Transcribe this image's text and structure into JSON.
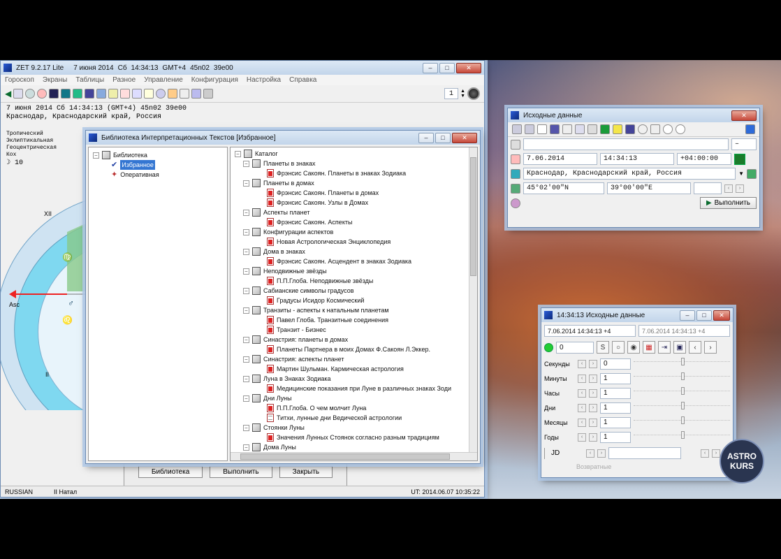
{
  "main_window": {
    "title": "ZET 9.2.17 Lite",
    "title_date": "7 июня 2014",
    "title_day": "Сб",
    "title_time": "14:34:13",
    "title_tz": "GMT+4",
    "title_lat": "45n02",
    "title_lon": "39e00",
    "menu": [
      "Гороскоп",
      "Экраны",
      "Таблицы",
      "Разное",
      "Управление",
      "Конфигурация",
      "Настройка",
      "Справка"
    ],
    "page_number": "1",
    "info_line1": "7 июня 2014   Сб   14:34:13  (GMT+4) 45n02  39e00",
    "info_line2": "Краснодар, Краснодарский край, Россия",
    "left_labels": [
      "Тропический",
      "Эклиптикальная",
      "Геоцентрическая",
      "Кох"
    ],
    "moon_label": "10",
    "chart_labels": {
      "xii": "XII",
      "ii": "II",
      "asc": "Asc"
    },
    "glyphs": [
      "♍",
      "♂",
      "♌"
    ],
    "status_lang": "RUSSIAN",
    "status_natal": "II Натал",
    "status_ut": "UT: 2014.06.07 10:35:22"
  },
  "hidden_dialog": {
    "library_button": "Библиотека",
    "execute_button": "Выполнить",
    "close_button": "Закрыть"
  },
  "library_window": {
    "title": "Библиотека Интерпретационных Текстов [Избранное]",
    "left_root": "Библиотека",
    "left_items": [
      "Избранное",
      "Оперативная"
    ],
    "catalog_root": "Каталог",
    "categories": [
      {
        "name": "Планеты в знаках",
        "items": [
          "Фрэнсис Сакоян. Планеты в знаках Зодиака"
        ]
      },
      {
        "name": "Планеты в домах",
        "items": [
          "Фрэнсис Сакоян. Планеты в домах",
          "Фрэнсис Сакоян. Узлы в Домах"
        ]
      },
      {
        "name": "Аспекты планет",
        "items": [
          "Фрэнсис Сакоян. Аспекты"
        ]
      },
      {
        "name": "Конфигурации аспектов",
        "items": [
          "Новая Астрологическая Энциклопедия"
        ]
      },
      {
        "name": "Дома в знаках",
        "items": [
          "Фрэнсис Сакоян. Асцендент в знаках Зодиака"
        ]
      },
      {
        "name": "Неподвижные звёзды",
        "items": [
          "П.П.Глоба. Неподвижные звёзды"
        ]
      },
      {
        "name": "Сабианские символы градусов",
        "items": [
          "Градусы Исидор Космический"
        ]
      },
      {
        "name": "Транзиты - аспекты к натальным планетам",
        "items": [
          "Павел Глоба. Транзитные соединения",
          "Транзит - Бизнес"
        ]
      },
      {
        "name": "Синастрия: планеты в домах",
        "items": [
          "Планеты Партнера в моих Домах Ф.Сакоян Л.Эккер."
        ]
      },
      {
        "name": "Синастрия: аспекты планет",
        "items": [
          "Мартин Шульман. Кармическая астрология"
        ]
      },
      {
        "name": "Луна в Знаках Зодиака",
        "items": [
          "Медицинские показания при Луне в различных знаках Зоди"
        ]
      },
      {
        "name": "Дни Луны",
        "items": [
          "П.П.Глоба. О чем молчит Луна",
          "Титхи, лунные дни Ведической астрологии"
        ]
      },
      {
        "name": "Стоянки Луны",
        "items": [
          "Значения Лунных Стоянок согласно разным традициям"
        ]
      },
      {
        "name": "Дома Луны",
        "items": []
      }
    ]
  },
  "source_window": {
    "title": "Исходные данные",
    "date": "7.06.2014",
    "time": "14:34:13",
    "offset": "+04:00:00",
    "place": "Краснодар, Краснодарский край, Россия",
    "latitude": "45°02'00\"N",
    "longitude": "39°00'00\"E",
    "name_value": "",
    "execute_label": "Выполнить",
    "tz_select": "–"
  },
  "time_window": {
    "title": "14:34:13 Исходные данные",
    "header_left": "7.06.2014  14:34:13  +4",
    "header_right": "7.06.2014   14:34:13  +4",
    "step_value": "0",
    "rows": [
      {
        "label": "Секунды",
        "value": "0"
      },
      {
        "label": "Минуты",
        "value": "1"
      },
      {
        "label": "Часы",
        "value": "1"
      },
      {
        "label": "Дни",
        "value": "1"
      },
      {
        "label": "Месяцы",
        "value": "1"
      },
      {
        "label": "Годы",
        "value": "1"
      }
    ],
    "jd_label": "JD",
    "jd_value": "",
    "bottom_text": "Возвратные"
  },
  "logo": {
    "line1": "ASTRO",
    "line2": "KURS"
  }
}
